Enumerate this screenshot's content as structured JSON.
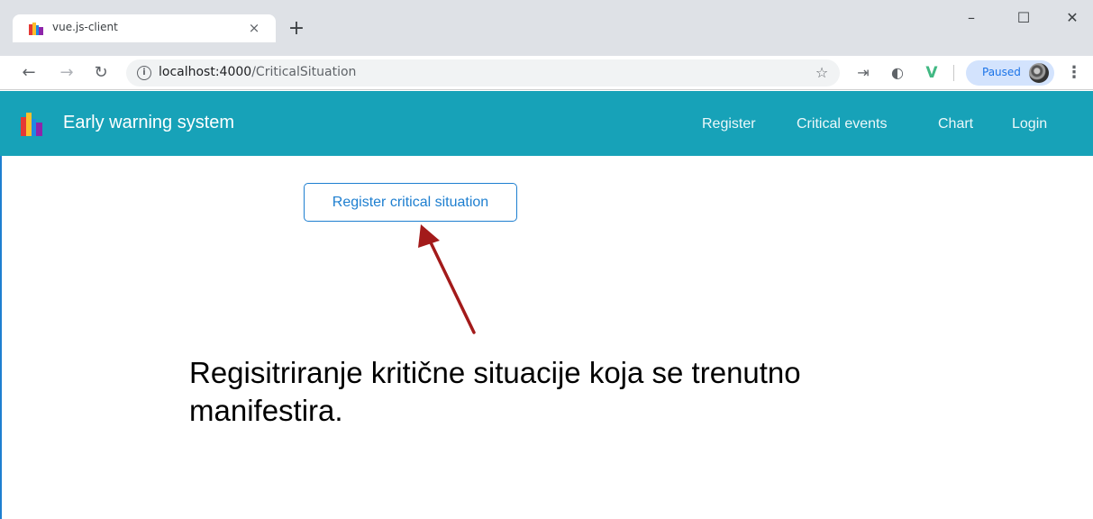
{
  "browser": {
    "tab_title": "vue.js-client",
    "tab_close": "×",
    "new_tab": "+",
    "window": {
      "minimize": "–",
      "maximize": "☐",
      "close": "✕"
    },
    "url_host": "localhost:4000",
    "url_path": "/CriticalSituation",
    "info_glyph": "i",
    "profile_status": "Paused",
    "icons": [
      "back-arrow-icon",
      "forward-arrow-icon",
      "reload-icon",
      "info-icon",
      "star-icon",
      "extension-arrow-icon",
      "extension-circle-icon",
      "vue-devtools-icon",
      "profile-avatar-icon",
      "more-menu-icon"
    ]
  },
  "navbar": {
    "brand": "Early warning system",
    "links": [
      "Register",
      "Critical events",
      "Chart",
      "Login"
    ],
    "background": "#17a2b8"
  },
  "main": {
    "button_label": "Register critical situation",
    "button_color": "#1e7fd0",
    "annotation_line1": "Regisitriranje kritične situacije koja se trenutno",
    "annotation_line2": "manifestira.",
    "arrow_color": "#a31a1a"
  }
}
